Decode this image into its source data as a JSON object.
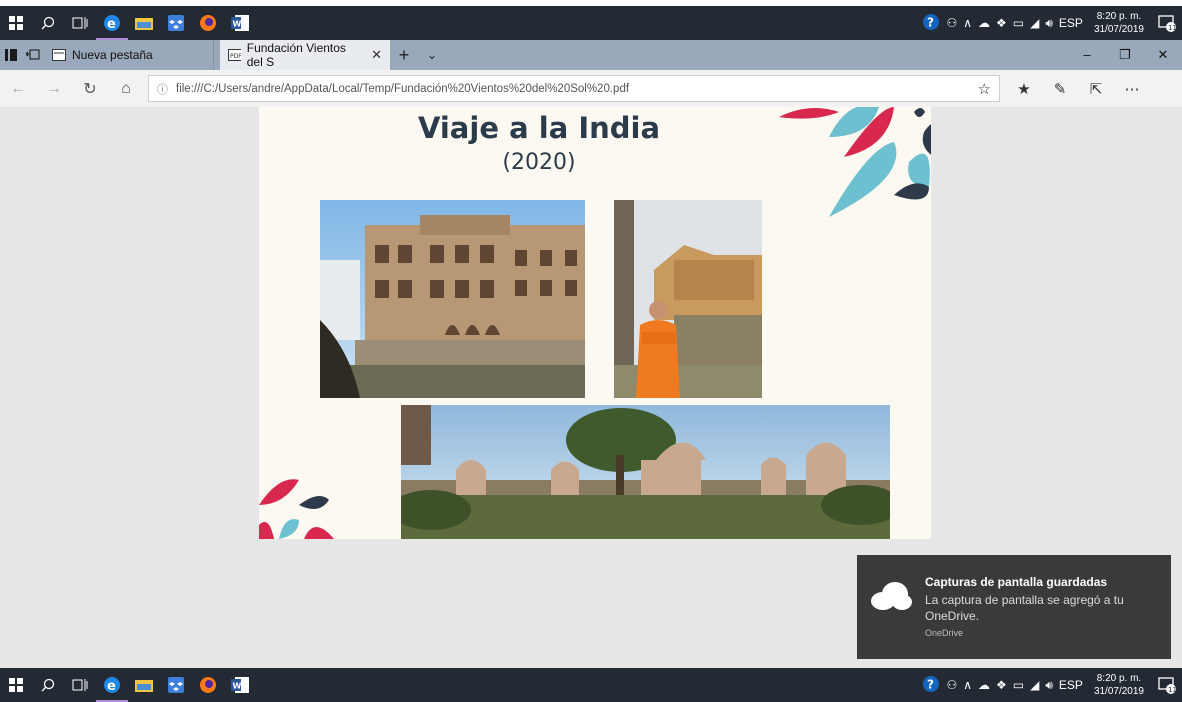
{
  "taskbar": {
    "icons": [
      "windows-start-icon",
      "search-icon",
      "task-view-icon",
      "edge-icon",
      "file-explorer-icon",
      "dropbox-icon",
      "firefox-icon",
      "word-icon"
    ],
    "language": "ESP",
    "time": "8:20 p. m.",
    "date": "31/07/2019",
    "notification_count": "11"
  },
  "tabs": [
    {
      "label": "Nueva pestaña"
    },
    {
      "label": "Fundación Vientos del S"
    }
  ],
  "address": {
    "url": "file:///C:/Users/andre/AppData/Local/Temp/Fundación%20Vientos%20del%20Sol%20.pdf"
  },
  "slide": {
    "title": "Viaje a la India",
    "subtitle": "(2020)"
  },
  "toast": {
    "title": "Capturas de pantalla guardadas",
    "body": "La captura de pantalla se agregó a tu OneDrive.",
    "source": "OneDrive"
  },
  "colors": {
    "taskbar": "#232a34",
    "tabbar": "#99a8bb",
    "accent_red": "#d8284e",
    "accent_teal": "#6cc0cf",
    "accent_navy": "#2e3a4a"
  }
}
